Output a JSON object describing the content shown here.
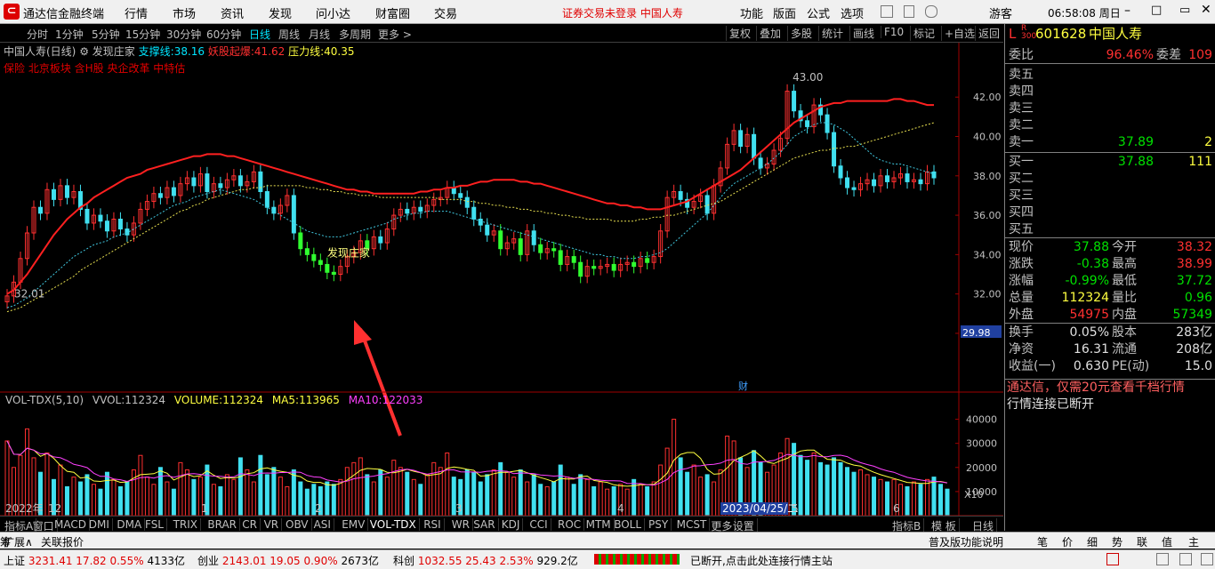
{
  "titlebar": {
    "app_title": "通达信金融终端",
    "menus": [
      "行情",
      "市场",
      "资讯",
      "发现",
      "问小达",
      "财富圈",
      "交易"
    ],
    "notice": "证券交易未登录  中国人寿",
    "right_menus": [
      "功能",
      "版面",
      "公式",
      "选项"
    ],
    "user": "游客",
    "clock": "06:58:08 周日"
  },
  "toolbar": {
    "periods": [
      "分时",
      "1分钟",
      "5分钟",
      "15分钟",
      "30分钟",
      "60分钟",
      "日线",
      "周线",
      "月线",
      "多周期",
      "更多 >"
    ],
    "active": "日线",
    "tools": [
      "复权",
      "叠加",
      "多股",
      "统计",
      "画线",
      "F10",
      "标记",
      "+自选",
      "返回"
    ]
  },
  "info": {
    "name": "中国人寿(日线)",
    "indicator": "发现庄家",
    "support_label": "支撑线:",
    "support_value": "38.16",
    "demon_label": "妖股起爆:",
    "demon_value": "41.62",
    "pressure_label": "压力线:",
    "pressure_value": "40.35",
    "tags": "保险 北京板块 含H股 央企改革 中特估"
  },
  "chart_data": {
    "type": "candlestick",
    "title": "中国人寿(日线)",
    "price_axis": [
      "42.00",
      "40.00",
      "38.00",
      "36.00",
      "34.00",
      "32.00",
      "30.00"
    ],
    "ylim": [
      29.5,
      43.5
    ],
    "current_price_tag": "29.98",
    "annotations": {
      "high": "43.00",
      "low": "32.01",
      "signal": "发现庄家",
      "fin_marker": "财"
    },
    "x_labels": [
      "2022年",
      "12",
      "1",
      "2",
      "3",
      "4",
      "2023/04/25/二",
      "5",
      "6"
    ],
    "volume_panel": {
      "title": "VOL-TDX(5,10)",
      "vvol_label": "VVOL:",
      "vvol": "112324",
      "volume_label": "VOLUME:",
      "volume": "112324",
      "ma5_label": "MA5:",
      "ma5": "113965",
      "ma10_label": "MA10:",
      "ma10": "122033",
      "axis": [
        "40000",
        "30000",
        "20000",
        "10000"
      ],
      "unit": "X10"
    },
    "close": [
      31.9,
      32.6,
      33.8,
      35.1,
      36.4,
      36.1,
      37.3,
      36.8,
      37.5,
      36.9,
      37.2,
      36.3,
      35.6,
      36.0,
      35.7,
      35.2,
      35.8,
      35.3,
      35.0,
      35.6,
      36.3,
      36.7,
      37.1,
      36.9,
      37.4,
      37.0,
      37.6,
      37.9,
      37.5,
      38.1,
      37.2,
      37.6,
      37.4,
      37.8,
      38.0,
      37.5,
      37.7,
      38.2,
      37.2,
      36.4,
      36.1,
      36.5,
      37.0,
      35.1,
      34.3,
      34.0,
      33.7,
      33.5,
      33.1,
      33.0,
      33.4,
      33.9,
      34.1,
      34.7,
      34.3,
      34.9,
      34.6,
      35.3,
      36.0,
      36.3,
      36.1,
      36.4,
      36.2,
      36.5,
      36.8,
      36.9,
      37.4,
      37.1,
      36.9,
      36.4,
      35.8,
      35.5,
      35.0,
      35.2,
      34.3,
      34.6,
      34.8,
      34.0,
      35.2,
      34.5,
      34.1,
      34.3,
      34.2,
      33.5,
      33.9,
      33.6,
      32.9,
      33.4,
      33.3,
      33.4,
      33.5,
      33.2,
      33.5,
      33.6,
      33.4,
      33.8,
      33.6,
      33.9,
      35.2,
      36.9,
      37.2,
      36.8,
      36.4,
      36.7,
      37.0,
      36.1,
      37.5,
      38.4,
      39.6,
      40.3,
      39.5,
      40.1,
      38.9,
      38.4,
      38.6,
      39.3,
      39.9,
      42.3,
      41.3,
      40.8,
      40.5,
      41.6,
      41.1,
      40.2,
      38.5,
      37.9,
      37.4,
      37.3,
      37.6,
      37.8,
      37.5,
      38.0,
      37.7,
      37.9,
      38.1,
      37.7,
      37.8,
      37.6,
      38.2,
      37.9
    ],
    "ma_red": [
      32.0,
      32.2,
      32.6,
      33.0,
      33.5,
      34.0,
      34.5,
      35.0,
      35.4,
      35.8,
      36.1,
      36.4,
      36.6,
      36.9,
      37.1,
      37.3,
      37.5,
      37.7,
      37.9,
      38.0,
      38.1,
      38.3,
      38.4,
      38.5,
      38.6,
      38.7,
      38.8,
      38.9,
      39.0,
      39.0,
      39.1,
      39.1,
      39.1,
      39.0,
      39.0,
      38.9,
      38.8,
      38.7,
      38.6,
      38.5,
      38.4,
      38.3,
      38.2,
      38.1,
      38.0,
      37.9,
      37.8,
      37.7,
      37.6,
      37.5,
      37.4,
      37.3,
      37.3,
      37.2,
      37.2,
      37.1,
      37.1,
      37.1,
      37.1,
      37.1,
      37.1,
      37.1,
      37.2,
      37.2,
      37.3,
      37.3,
      37.4,
      37.4,
      37.5,
      37.5,
      37.6,
      37.7,
      37.7,
      37.8,
      37.8,
      37.8,
      37.8,
      37.7,
      37.7,
      37.6,
      37.6,
      37.5,
      37.4,
      37.3,
      37.2,
      37.1,
      37.0,
      36.9,
      36.8,
      36.7,
      36.6,
      36.6,
      36.5,
      36.5,
      36.4,
      36.4,
      36.3,
      36.3,
      36.3,
      36.4,
      36.5,
      36.6,
      36.7,
      36.9,
      37.1,
      37.3,
      37.5,
      37.7,
      37.9,
      38.1,
      38.3,
      38.6,
      38.9,
      39.2,
      39.5,
      39.8,
      40.1,
      40.4,
      40.7,
      40.9,
      41.1,
      41.3,
      41.5,
      41.6,
      41.7,
      41.7,
      41.8,
      41.8,
      41.8,
      41.8,
      41.8,
      41.8,
      41.8,
      41.9,
      41.9,
      41.8,
      41.8,
      41.7,
      41.6,
      41.6
    ],
    "ma_cyan": [
      31.3,
      31.4,
      31.6,
      31.8,
      32.1,
      32.4,
      32.7,
      33.0,
      33.3,
      33.6,
      33.9,
      34.1,
      34.3,
      34.5,
      34.6,
      34.7,
      34.9,
      35.0,
      35.1,
      35.3,
      35.5,
      35.7,
      35.9,
      36.1,
      36.3,
      36.5,
      36.6,
      36.7,
      36.9,
      37.0,
      37.1,
      37.2,
      37.3,
      37.2,
      37.1,
      37.0,
      36.9,
      36.8,
      36.6,
      36.4,
      36.2,
      36.0,
      35.8,
      35.6,
      35.4,
      35.2,
      35.1,
      35.0,
      34.9,
      34.9,
      34.9,
      35.0,
      35.1,
      35.2,
      35.3,
      35.4,
      35.5,
      35.6,
      35.8,
      35.9,
      36.0,
      36.1,
      36.1,
      36.2,
      36.2,
      36.2,
      36.2,
      36.1,
      36.0,
      35.9,
      35.8,
      35.7,
      35.6,
      35.5,
      35.4,
      35.3,
      35.2,
      35.1,
      35.0,
      34.9,
      34.8,
      34.7,
      34.6,
      34.5,
      34.4,
      34.3,
      34.2,
      34.1,
      34.0,
      34.0,
      33.9,
      33.9,
      33.8,
      33.8,
      33.8,
      33.9,
      33.9,
      34.0,
      34.1,
      34.3,
      34.6,
      34.9,
      35.2,
      35.5,
      35.8,
      36.1,
      36.5,
      36.9,
      37.3,
      37.6,
      37.8,
      38.0,
      38.2,
      38.4,
      38.6,
      38.9,
      39.2,
      39.6,
      40.0,
      40.2,
      40.4,
      40.6,
      40.7,
      40.7,
      40.6,
      40.4,
      40.2,
      39.9,
      39.6,
      39.3,
      39.0,
      38.8,
      38.7,
      38.6,
      38.6,
      38.5,
      38.4,
      38.3,
      38.2,
      38.1
    ],
    "ma_yellow": [
      31.1,
      31.2,
      31.3,
      31.5,
      31.7,
      31.9,
      32.1,
      32.3,
      32.5,
      32.7,
      32.9,
      33.2,
      33.4,
      33.6,
      33.8,
      34.0,
      34.2,
      34.4,
      34.6,
      34.8,
      35.0,
      35.2,
      35.4,
      35.6,
      35.8,
      36.0,
      36.2,
      36.3,
      36.5,
      36.6,
      36.8,
      36.9,
      37.0,
      37.1,
      37.2,
      37.3,
      37.3,
      37.4,
      37.4,
      37.5,
      37.5,
      37.5,
      37.5,
      37.5,
      37.5,
      37.4,
      37.4,
      37.3,
      37.3,
      37.2,
      37.2,
      37.1,
      37.1,
      37.0,
      37.0,
      37.0,
      36.9,
      36.9,
      36.9,
      36.9,
      36.9,
      36.9,
      36.9,
      36.9,
      36.9,
      36.8,
      36.8,
      36.8,
      36.8,
      36.7,
      36.7,
      36.6,
      36.6,
      36.5,
      36.5,
      36.4,
      36.4,
      36.3,
      36.3,
      36.2,
      36.2,
      36.1,
      36.1,
      36.0,
      36.0,
      35.9,
      35.9,
      35.8,
      35.8,
      35.8,
      35.8,
      35.7,
      35.7,
      35.7,
      35.7,
      35.8,
      35.8,
      35.9,
      35.9,
      36.0,
      36.0,
      36.1,
      36.2,
      36.3,
      36.4,
      36.5,
      36.6,
      36.7,
      36.9,
      37.1,
      37.3,
      37.5,
      37.7,
      37.9,
      38.1,
      38.3,
      38.5,
      38.7,
      38.9,
      39.0,
      39.1,
      39.2,
      39.3,
      39.3,
      39.4,
      39.4,
      39.5,
      39.5,
      39.6,
      39.7,
      39.8,
      39.9,
      40.0,
      40.1,
      40.2,
      40.3,
      40.4,
      40.5,
      40.6,
      40.7
    ],
    "volume": [
      31000,
      20000,
      25000,
      36000,
      24000,
      18000,
      26000,
      15000,
      21000,
      12000,
      16000,
      14000,
      17000,
      13000,
      11000,
      18000,
      15000,
      12000,
      14000,
      19000,
      25000,
      16000,
      13000,
      20000,
      14000,
      11000,
      22000,
      19000,
      15000,
      16000,
      21000,
      13000,
      12000,
      17000,
      15000,
      24000,
      19000,
      14000,
      25000,
      17000,
      20000,
      16000,
      12000,
      19000,
      14000,
      11000,
      13000,
      12000,
      14000,
      13000,
      15000,
      20000,
      22000,
      24000,
      17000,
      14000,
      19000,
      16000,
      23000,
      20000,
      18000,
      15000,
      13000,
      17000,
      22000,
      20000,
      26000,
      16000,
      15000,
      19000,
      18000,
      14000,
      17000,
      19000,
      22000,
      18000,
      16000,
      19000,
      14000,
      17000,
      13000,
      12000,
      14000,
      21000,
      16000,
      13000,
      17000,
      15000,
      12000,
      14000,
      11000,
      12000,
      13000,
      11000,
      15000,
      13000,
      12000,
      14000,
      21000,
      28000,
      40000,
      24000,
      18000,
      21000,
      16000,
      17000,
      14000,
      19000,
      33000,
      31000,
      24000,
      20000,
      27000,
      22000,
      18000,
      21000,
      26000,
      32000,
      30000,
      25000,
      23000,
      26000,
      22000,
      21000,
      24000,
      22000,
      20000,
      18000,
      19000,
      17000,
      16000,
      15000,
      14000,
      15000,
      13000,
      12000,
      14000,
      13000,
      15000,
      16000,
      13000,
      11000
    ]
  },
  "right_panel": {
    "code_prefix": "L",
    "code_badge": "R 300",
    "code": "601628",
    "name": "中国人寿",
    "webi_label": "委比",
    "webi": "96.46%",
    "weicha_label": "委差",
    "weicha": "109",
    "sell": [
      {
        "label": "卖五",
        "price": "",
        "vol": ""
      },
      {
        "label": "卖四",
        "price": "",
        "vol": ""
      },
      {
        "label": "卖三",
        "price": "",
        "vol": ""
      },
      {
        "label": "卖二",
        "price": "",
        "vol": ""
      },
      {
        "label": "卖一",
        "price": "37.89",
        "vol": "2"
      }
    ],
    "buy": [
      {
        "label": "买一",
        "price": "37.88",
        "vol": "111"
      },
      {
        "label": "买二",
        "price": "",
        "vol": ""
      },
      {
        "label": "买三",
        "price": "",
        "vol": ""
      },
      {
        "label": "买四",
        "price": "",
        "vol": ""
      },
      {
        "label": "买五",
        "price": "",
        "vol": ""
      }
    ],
    "stats": [
      {
        "l1": "现价",
        "v1": "37.88",
        "c1": "down",
        "l2": "今开",
        "v2": "38.32",
        "c2": "up"
      },
      {
        "l1": "涨跌",
        "v1": "-0.38",
        "c1": "down",
        "l2": "最高",
        "v2": "38.99",
        "c2": "up"
      },
      {
        "l1": "涨幅",
        "v1": "-0.99%",
        "c1": "down",
        "l2": "最低",
        "v2": "37.72",
        "c2": "down"
      },
      {
        "l1": "总量",
        "v1": "112324",
        "c1": "yellow",
        "l2": "量比",
        "v2": "0.96",
        "c2": "down"
      },
      {
        "l1": "外盘",
        "v1": "54975",
        "c1": "up",
        "l2": "内盘",
        "v2": "57349",
        "c2": "down"
      }
    ],
    "stats2": [
      {
        "l1": "换手",
        "v1": "0.05%",
        "l2": "股本",
        "v2": "283亿"
      },
      {
        "l1": "净资",
        "v1": "16.31",
        "l2": "流通",
        "v2": "208亿"
      },
      {
        "l1": "收益(一)",
        "v1": "0.630",
        "l2": "PE(动)",
        "v2": "15.0"
      }
    ],
    "promo": "通达信，仅需20元查看千档行情",
    "connection": "行情连接已断开"
  },
  "bottom_tabs": {
    "items": [
      "指标A",
      "窗口",
      "MACD",
      "DMI",
      "DMA",
      "FSL",
      "TRIX",
      "BRAR",
      "CR",
      "VR",
      "OBV",
      "ASI",
      "EMV",
      "VOL-TDX",
      "RSI",
      "WR",
      "SAR",
      "KDJ",
      "CCI",
      "ROC",
      "MTM",
      "BOLL",
      "PSY",
      "MCST",
      "更多",
      "设置"
    ],
    "active": "VOL-TDX",
    "right_items": [
      "指标B",
      "模 板"
    ],
    "period": "日线"
  },
  "ext_row": {
    "left": [
      "扩展∧",
      "关联报价"
    ],
    "right": [
      "普及版功能说明",
      "笔",
      "价",
      "细",
      "势",
      "联",
      "值",
      "主",
      "筹"
    ]
  },
  "statusbar": {
    "sh_label": "上证",
    "sh": "3231.41",
    "sh_chg": "17.82",
    "sh_pct": "0.55%",
    "sh_amt": "4133亿",
    "cy_label": "创业",
    "cy": "2143.01",
    "cy_chg": "19.05",
    "cy_pct": "0.90%",
    "cy_amt": "2673亿",
    "kc_label": "科创",
    "kc": "1032.55",
    "kc_chg": "25.43",
    "kc_pct": "2.53%",
    "kc_amt": "929.2亿",
    "message": "已断开,点击此处连接行情主站"
  }
}
